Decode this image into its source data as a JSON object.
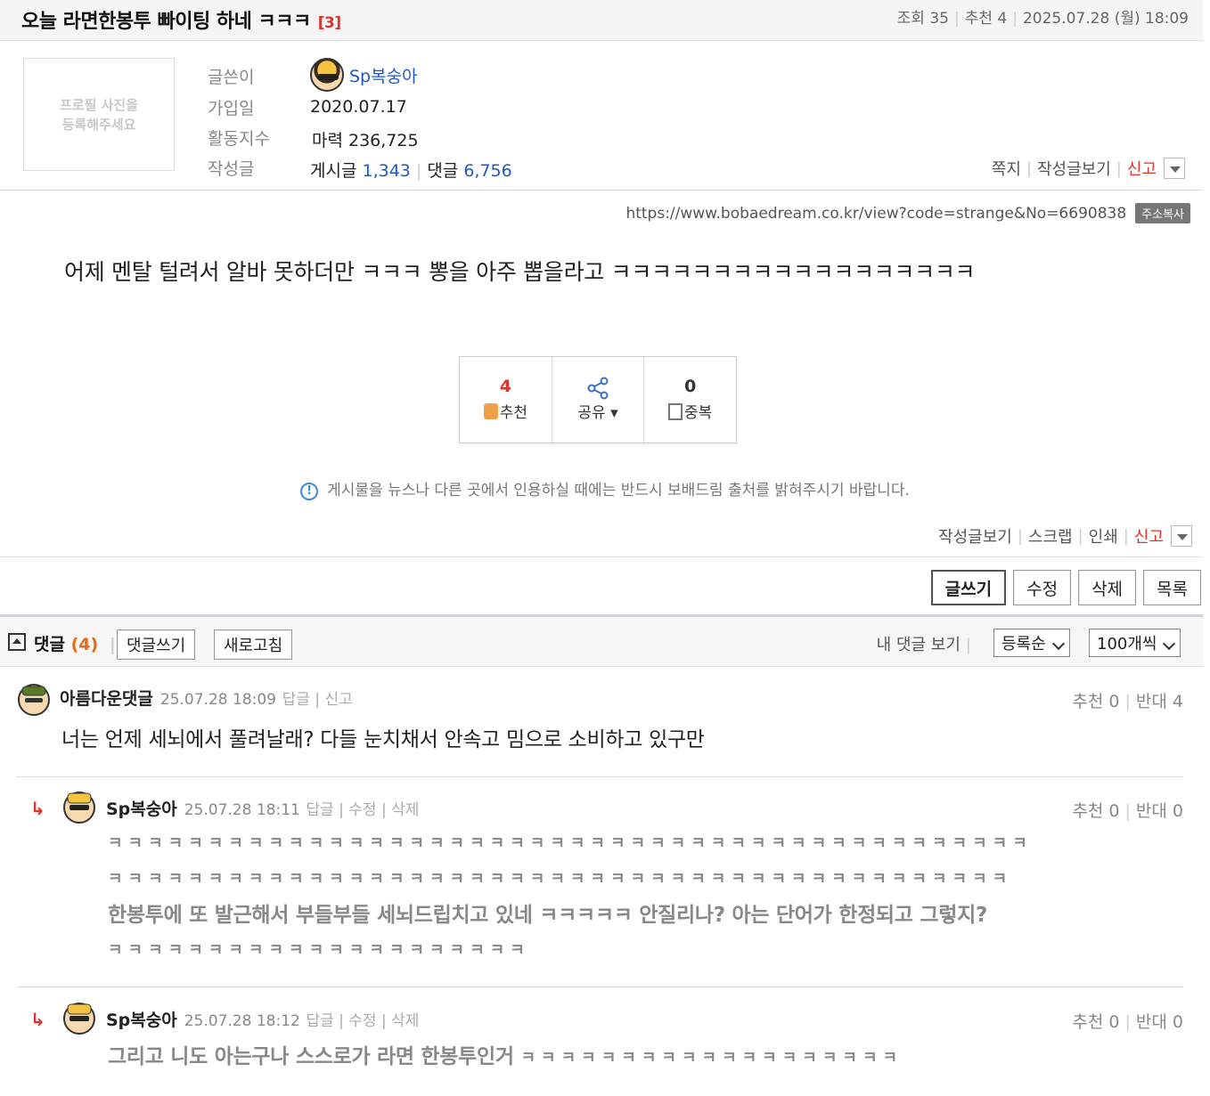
{
  "post": {
    "title": "오늘 라면한봉투 빠이팅 하네 ㅋㅋㅋ",
    "comment_count": "[3]",
    "views": "조회 35",
    "recommend": "추천 4",
    "datetime": "2025.07.28 (월) 18:09"
  },
  "profile": {
    "photo_placeholder": "프로필 사진을\n등록해주세요",
    "label_author": "글쓴이",
    "author": "Sp복숭아",
    "label_joined": "가입일",
    "joined": "2020.07.17",
    "label_activity": "활동지수",
    "activity": "마력 236,725",
    "label_posts": "작성글",
    "posts_label": "게시글",
    "posts_count": "1,343",
    "replies_label": "댓글",
    "replies_count": "6,756",
    "links": [
      "쪽지",
      "작성글보기",
      "신고"
    ]
  },
  "url": {
    "text": "https://www.bobaedream.co.kr/view?code=strange&No=6690838",
    "copy_label": "주소복사"
  },
  "content": {
    "body": "어제 멘탈 털려서 알바 못하더만 ㅋㅋㅋ 뽕을 아주 뽑을라고 ㅋㅋㅋㅋㅋㅋㅋㅋㅋㅋㅋㅋㅋㅋㅋㅋㅋㅋ"
  },
  "votes": {
    "recommend_count": "4",
    "recommend_label": "추천",
    "share_label": "공유",
    "dup_count": "0",
    "dup_label": "중복"
  },
  "notice": "게시물을 뉴스나 다른 곳에서 인용하실 때에는 반드시 보배드림 출처를 밝혀주시기 바랍니다.",
  "bottom_links": [
    "작성글보기",
    "스크랩",
    "인쇄",
    "신고"
  ],
  "buttons": {
    "write": "글쓰기",
    "edit": "수정",
    "delete": "삭제",
    "list": "목록"
  },
  "comments_header": {
    "title": "댓글",
    "count": "(4)",
    "write": "댓글쓰기",
    "refresh": "새로고침",
    "my_comments": "내 댓글 보기",
    "sort": "등록순",
    "per_page": "100개씩"
  },
  "comments": [
    {
      "name": "아름다운댓글",
      "date": "25.07.28 18:09",
      "actions": "답글 | 신고",
      "up": "추천 0",
      "down": "반대 4",
      "text": "너는 언제 세뇌에서 풀려날래? 다들 눈치채서 안속고 밈으로 소비하고 있구만"
    },
    {
      "name": "Sp복숭아",
      "date": "25.07.28 18:11",
      "actions": "답글 | 수정 | 삭제",
      "up": "추천 0",
      "down": "반대 0",
      "lines": [
        "ㅋㅋㅋㅋㅋㅋㅋㅋㅋㅋㅋㅋㅋㅋㅋㅋㅋㅋㅋㅋㅋㅋㅋㅋㅋㅋㅋㅋㅋㅋㅋㅋㅋㅋㅋㅋㅋㅋㅋㅋㅋㅋㅋㅋㅋㅋ",
        "ㅋㅋㅋㅋㅋㅋㅋㅋㅋㅋㅋㅋㅋㅋㅋㅋㅋㅋㅋㅋㅋㅋㅋㅋㅋㅋㅋㅋㅋㅋㅋㅋㅋㅋㅋㅋㅋㅋㅋㅋㅋㅋㅋㅋㅋ",
        "한봉투에 또 발근해서 부들부들 세뇌드립치고 있네 ㅋㅋㅋㅋㅋ 안질리나? 아는 단어가 한정되고 그렇지?",
        "ㅋㅋㅋㅋㅋㅋㅋㅋㅋㅋㅋㅋㅋㅋㅋㅋㅋㅋㅋㅋㅋ"
      ]
    },
    {
      "name": "Sp복숭아",
      "date": "25.07.28 18:12",
      "actions": "답글 | 수정 | 삭제",
      "up": "추천 0",
      "down": "반대 0",
      "text": "그리고 니도 아는구나 스스로가 라면 한봉투인거",
      "suffix": "ㅋㅋㅋㅋㅋㅋㅋㅋㅋㅋㅋㅋㅋㅋㅋㅋㅋㅋㅋ"
    }
  ],
  "colors": {
    "accent_red": "#e0312b",
    "link_blue": "#1e58c4",
    "orange": "#e86a15"
  }
}
